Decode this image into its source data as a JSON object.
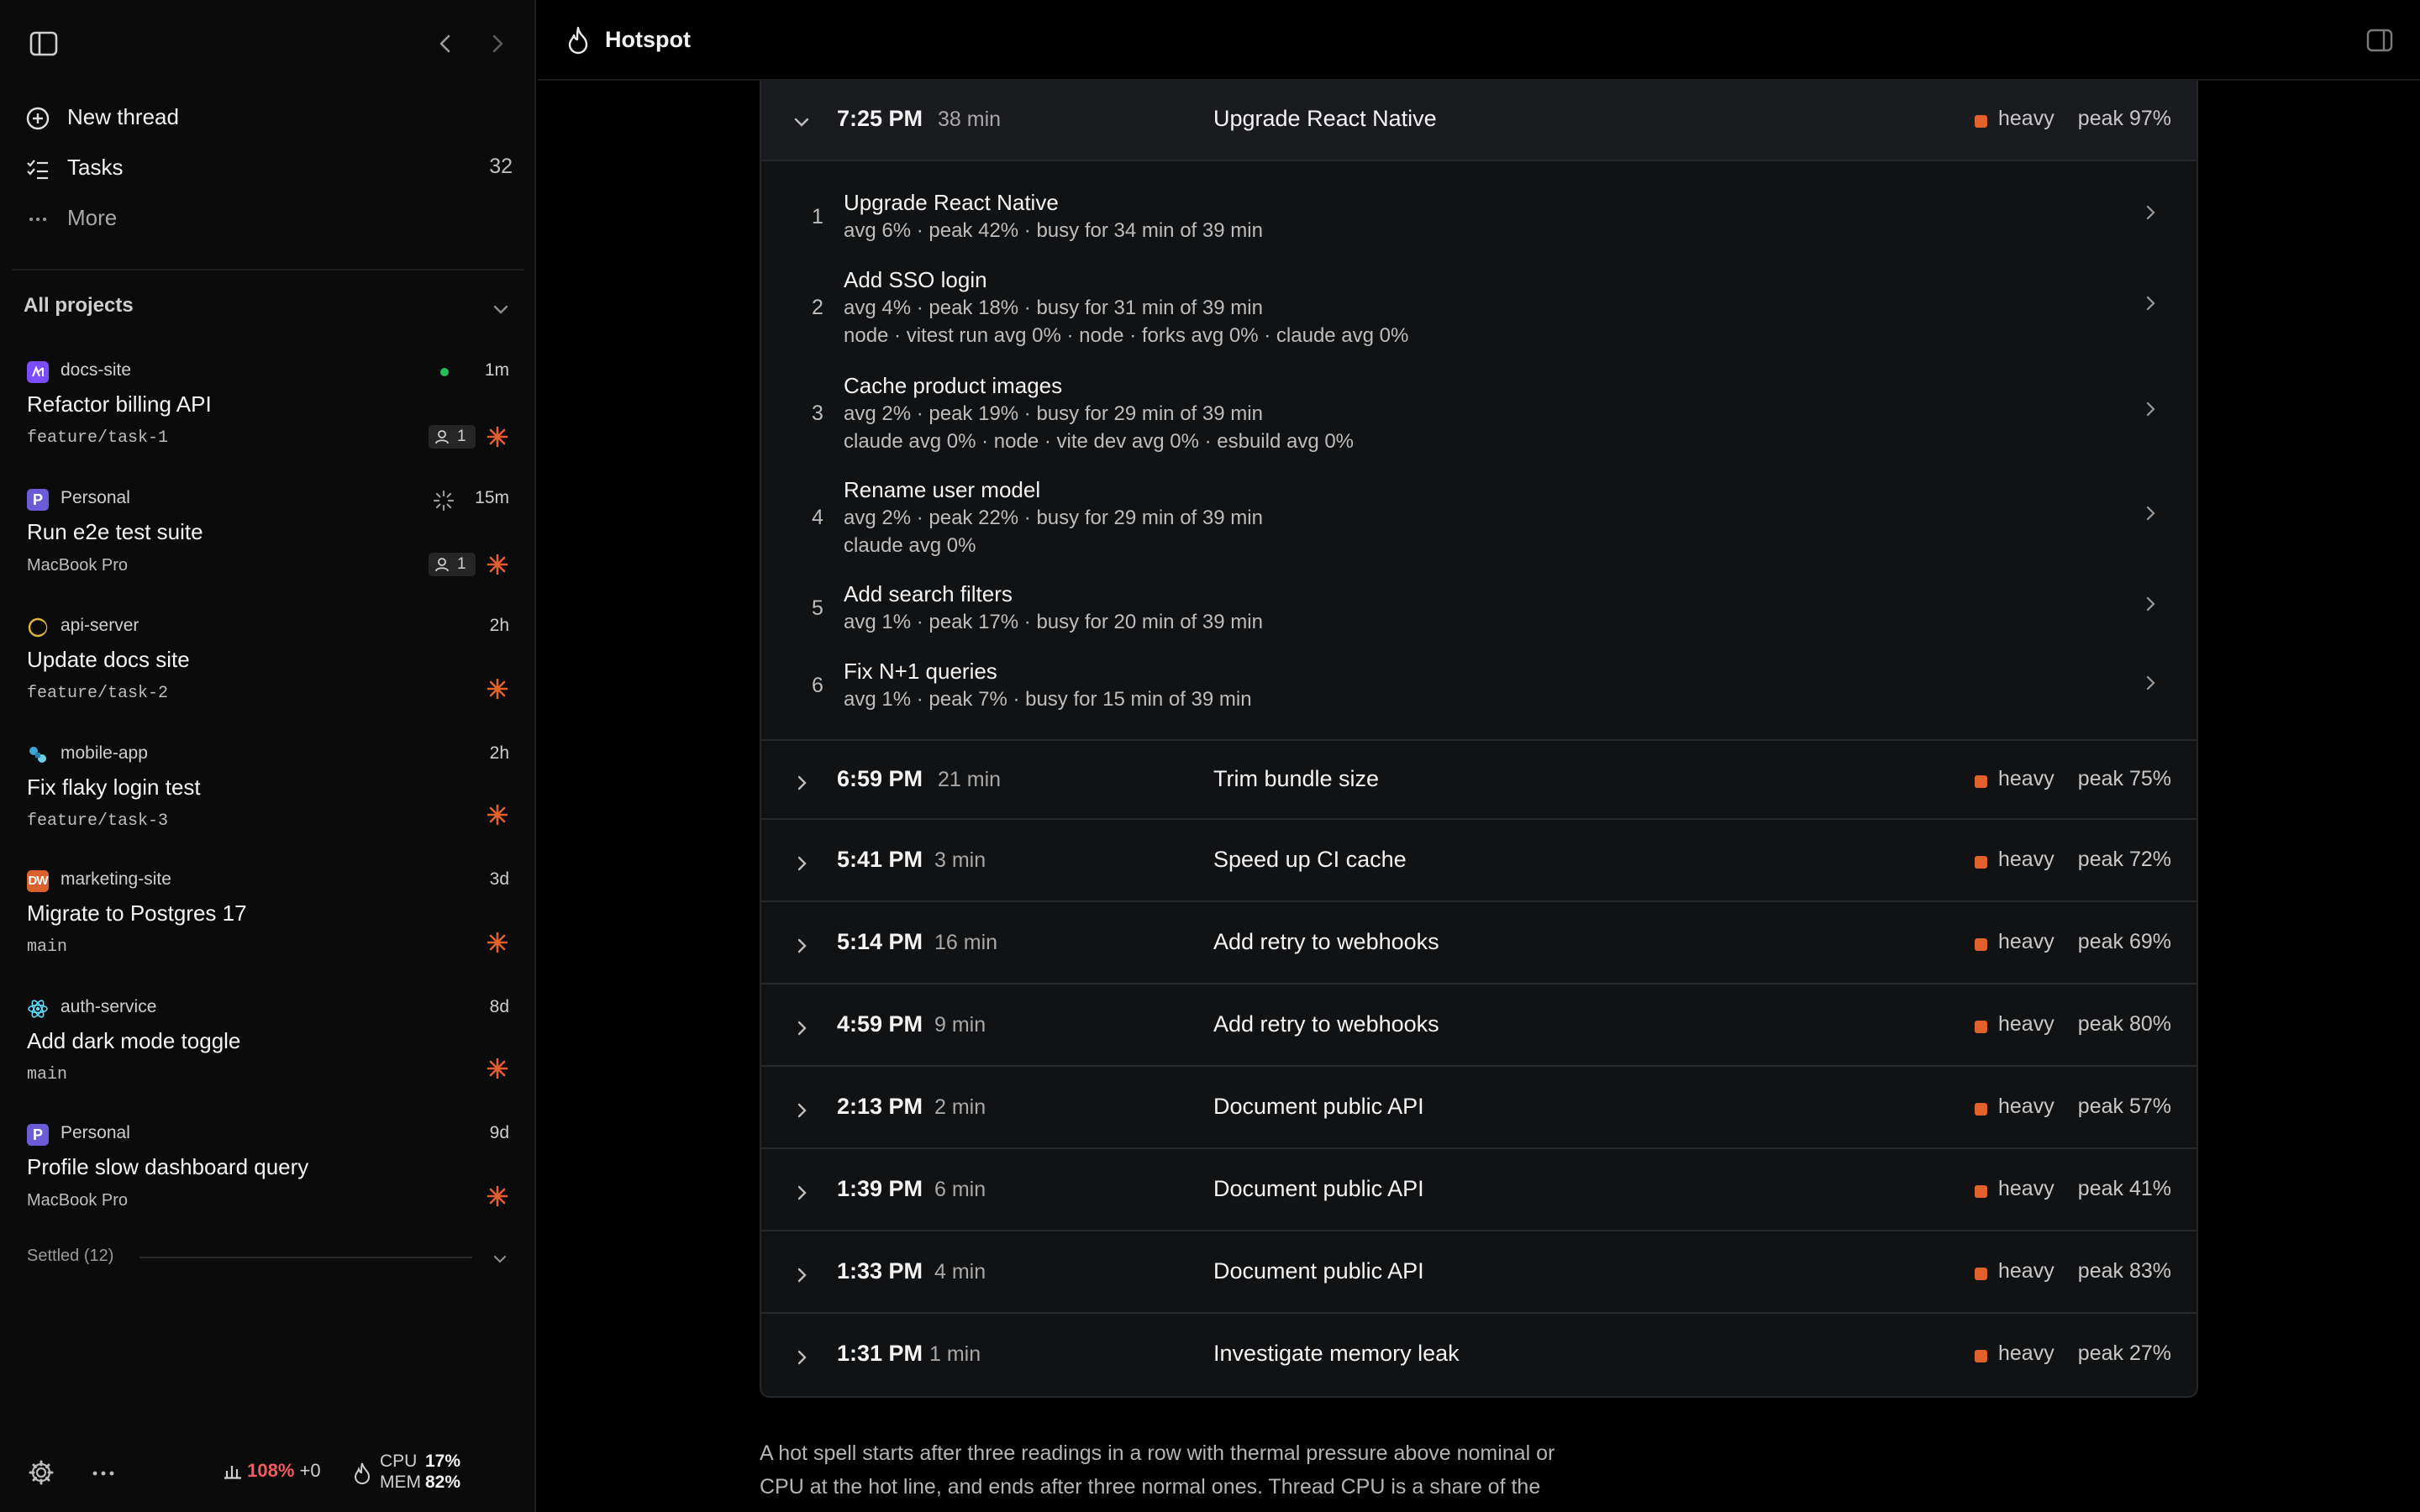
{
  "sidebar": {
    "nav": {
      "new_thread": "New thread",
      "tasks": "Tasks",
      "tasks_count": "32",
      "more": "More"
    },
    "section_title": "All projects",
    "threads": [
      {
        "project": "docs-site",
        "icon": "docs-site-logo-icon",
        "icon_color": "#7c4dff",
        "time": "1m",
        "title": "Refactor billing API",
        "sub": "feature/task-1",
        "sub_mono": true,
        "status": "running",
        "agents": "1"
      },
      {
        "project": "Personal",
        "icon_letter": "P",
        "icon_color": "#6b5bd6",
        "time": "15m",
        "title": "Run e2e test suite",
        "sub": "MacBook Pro",
        "sub_mono": false,
        "status": "loading",
        "agents": "1"
      },
      {
        "project": "api-server",
        "icon": "ring-logo-icon",
        "icon_color": "#e0b73a",
        "time": "2h",
        "title": "Update docs site",
        "sub": "feature/task-2",
        "sub_mono": true
      },
      {
        "project": "mobile-app",
        "icon": "puzzle-logo-icon",
        "icon_color": "#3fa7d6",
        "time": "2h",
        "title": "Fix flaky login test",
        "sub": "feature/task-3",
        "sub_mono": true
      },
      {
        "project": "marketing-site",
        "icon_letter": "DW",
        "icon_color": "#d8612c",
        "time": "3d",
        "title": "Migrate to Postgres 17",
        "sub": "main",
        "sub_mono": true
      },
      {
        "project": "auth-service",
        "icon": "react-logo-icon",
        "icon_color": "#61dafb",
        "time": "8d",
        "title": "Add dark mode toggle",
        "sub": "main",
        "sub_mono": true
      },
      {
        "project": "Personal",
        "icon_letter": "P",
        "icon_color": "#6b5bd6",
        "time": "9d",
        "title": "Profile slow dashboard query",
        "sub": "MacBook Pro",
        "sub_mono": false
      }
    ],
    "settled": "Settled (12)",
    "footer": {
      "load_pct": "108%",
      "load_delta": "+0",
      "cpu_label": "CPU",
      "cpu_value": "17%",
      "mem_label": "MEM",
      "mem_value": "82%"
    }
  },
  "topbar": {
    "title": "Hotspot"
  },
  "colors": {
    "heavy": "#e0622a",
    "running": "#2bbd5a",
    "burst": "#e0622a"
  },
  "expanded_spell": {
    "time": "7:25 PM",
    "duration": "38 min",
    "name": "Upgrade React Native",
    "level": "heavy",
    "peak": "peak 97%",
    "tasks": [
      {
        "num": "1",
        "name": "Upgrade React Native",
        "stats": "avg 6% · peak 42% · busy for 34 min of 39 min",
        "procs": ""
      },
      {
        "num": "2",
        "name": "Add SSO login",
        "stats": "avg 4% · peak 18% · busy for 31 min of 39 min",
        "procs": "node · vitest run avg 0% · node · forks avg 0% · claude avg 0%"
      },
      {
        "num": "3",
        "name": "Cache product images",
        "stats": "avg 2% · peak 19% · busy for 29 min of 39 min",
        "procs": "claude avg 0% · node · vite dev avg 0% · esbuild avg 0%"
      },
      {
        "num": "4",
        "name": "Rename user model",
        "stats": "avg 2% · peak 22% · busy for 29 min of 39 min",
        "procs": "claude avg 0%"
      },
      {
        "num": "5",
        "name": "Add search filters",
        "stats": "avg 1% · peak 17% · busy for 20 min of 39 min",
        "procs": ""
      },
      {
        "num": "6",
        "name": "Fix N+1 queries",
        "stats": "avg 1% · peak 7% · busy for 15 min of 39 min",
        "procs": ""
      }
    ]
  },
  "spells": [
    {
      "time": "6:59 PM",
      "duration": "21 min",
      "name": "Trim bundle size",
      "level": "heavy",
      "peak": "peak 75%"
    },
    {
      "time": "5:41 PM",
      "duration": "3 min",
      "name": "Speed up CI cache",
      "level": "heavy",
      "peak": "peak 72%"
    },
    {
      "time": "5:14 PM",
      "duration": "16 min",
      "name": "Add retry to webhooks",
      "level": "heavy",
      "peak": "peak 69%"
    },
    {
      "time": "4:59 PM",
      "duration": "9 min",
      "name": "Add retry to webhooks",
      "level": "heavy",
      "peak": "peak 80%"
    },
    {
      "time": "2:13 PM",
      "duration": "2 min",
      "name": "Document public API",
      "level": "heavy",
      "peak": "peak 57%"
    },
    {
      "time": "1:39 PM",
      "duration": "6 min",
      "name": "Document public API",
      "level": "heavy",
      "peak": "peak 41%"
    },
    {
      "time": "1:33 PM",
      "duration": "4 min",
      "name": "Document public API",
      "level": "heavy",
      "peak": "peak 83%"
    },
    {
      "time": "1:31 PM",
      "duration": "1 min",
      "name": "Investigate memory leak",
      "level": "heavy",
      "peak": "peak 27%"
    }
  ],
  "footnote": "A hot spell starts after three readings in a row with thermal pressure above nominal or CPU at the hot line, and ends after three normal ones. Thread CPU is a share of the"
}
